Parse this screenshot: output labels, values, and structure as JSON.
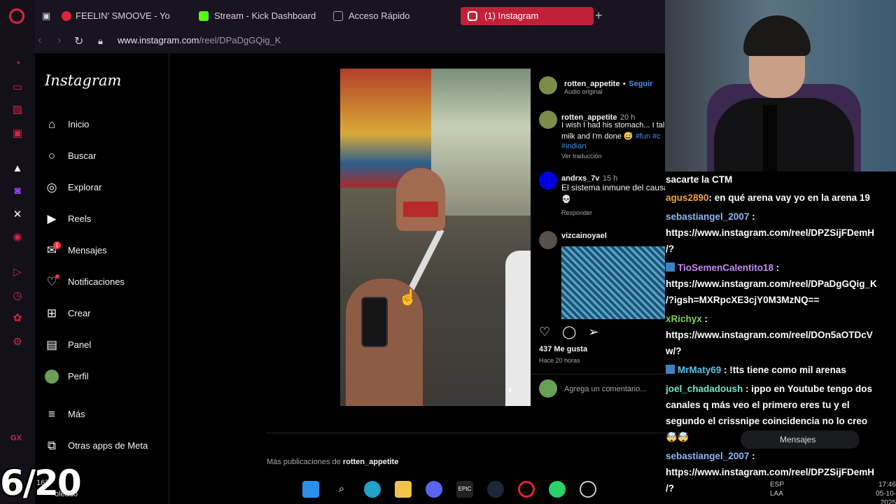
{
  "browser": {
    "tabs": [
      {
        "label": "FEELIN' SMOOVE - Yo"
      },
      {
        "label": "Stream - Kick Dashboard"
      },
      {
        "label": "Acceso Rápido"
      },
      {
        "label": "(1) Instagram"
      }
    ],
    "url_host": "www.instagram.com",
    "url_path": "/reel/DPaDgGQig_K",
    "gx_label": "GX"
  },
  "instagram": {
    "logo": "Instagram",
    "nav": {
      "inicio": "Inicio",
      "buscar": "Buscar",
      "explorar": "Explorar",
      "reels": "Reels",
      "mensajes": "Mensajes",
      "mensajes_badge": "1",
      "notificaciones": "Notificaciones",
      "crear": "Crear",
      "panel": "Panel",
      "perfil": "Perfil",
      "mas": "Más",
      "otras": "Otras apps de Meta"
    },
    "post": {
      "author": "rotten_appetite",
      "separator": "•",
      "follow": "Seguir",
      "audio": "Audio original",
      "caption_user": "rotten_appetite",
      "caption_time": "20 h",
      "caption_line1": "I wish I had his stomach... I tal",
      "caption_line2": "milk and I'm done 😅",
      "caption_tags": "#fun #c",
      "caption_tag2": "#indian",
      "translate": "Ver traducción",
      "c1_user": "andrxs_7v",
      "c1_time": "15 h",
      "c1_text": "El sistema inmune del causa",
      "c1_emoji": "💀",
      "c1_reply": "Responder",
      "c2_user": "vizcainoyael",
      "likes": "437 Me gusta",
      "ago": "Hace 20 horas",
      "add_comment": "Agrega un comentario..."
    },
    "more_prefix": "Más publicaciones de",
    "more_user": "rotten_appetite"
  },
  "chat": {
    "lines": [
      {
        "user": "",
        "text": "sacarte la CTM",
        "color": "#ffffff"
      },
      {
        "user": "agus2890",
        "text": ": en qué arena vay yo en la arena 19",
        "color": "#f2a03d"
      },
      {
        "user": "sebastiangel_2007",
        "text": " :",
        "color": "#8fb6f2"
      },
      {
        "user": "",
        "text": "https://www.instagram.com/reel/DPZSijFDemH",
        "color": "#ffffff"
      },
      {
        "user": "",
        "text": "/?",
        "color": "#ffffff"
      },
      {
        "user": "TioSemenCalentito18",
        "text": " :",
        "color": "#c58af5"
      },
      {
        "user": "",
        "text": "https://www.instagram.com/reel/DPaDgGQig_K",
        "color": "#ffffff"
      },
      {
        "user": "",
        "text": "/?igsh=MXRpcXE3cjY0M3MzNQ==",
        "color": "#ffffff"
      },
      {
        "user": "xRichyx",
        "text": " :",
        "color": "#7cd35a"
      },
      {
        "user": "",
        "text": "https://www.instagram.com/reel/DOn5aOTDcV",
        "color": "#ffffff"
      },
      {
        "user": "",
        "text": "w/?",
        "color": "#ffffff"
      },
      {
        "user": "MrMaty69",
        "text": " : !tts tiene como mil arenas",
        "color": "#59c3e6"
      },
      {
        "user": "joel_chadadoush",
        "text": " : ippo en Youtube tengo dos",
        "color": "#6ee9c9"
      },
      {
        "user": "",
        "text": "canales q más veo el primero eres tu y el",
        "color": "#ffffff"
      },
      {
        "user": "",
        "text": "segundo el crissnipe coincidencia no lo creo",
        "color": "#ffffff"
      },
      {
        "user": "",
        "text": "🤯🤯",
        "color": "#ffffff"
      },
      {
        "user": "sebastiangel_2007",
        "text": " :",
        "color": "#8fb6f2"
      },
      {
        "user": "",
        "text": "https://www.instagram.com/reel/DPZSijFDemH",
        "color": "#ffffff"
      },
      {
        "user": "",
        "text": "/?",
        "color": "#ffffff"
      }
    ],
    "messages_pill": "Mensajes"
  },
  "overlay": {
    "counter": "6/20",
    "weather_temp": "16°",
    "weather_desc": "oleado"
  },
  "taskbar": {
    "lang1": "ESP",
    "lang2": "LAA",
    "time": "17:46",
    "date": "05-10-2025"
  }
}
